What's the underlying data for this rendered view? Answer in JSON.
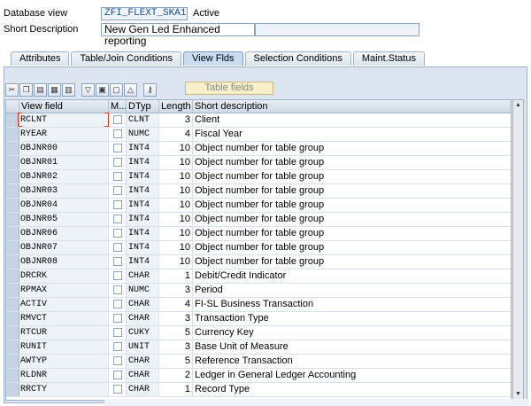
{
  "header": {
    "db_view_label": "Database view",
    "db_view_value": "ZFI_FLEXT_SKA1",
    "status": "Active",
    "short_desc_label": "Short Description",
    "short_desc_value": "New Gen Led Enhanced reporting"
  },
  "tabs": [
    {
      "label": "Attributes"
    },
    {
      "label": "Table/Join Conditions"
    },
    {
      "label": "View Flds"
    },
    {
      "label": "Selection Conditions"
    },
    {
      "label": "Maint.Status"
    }
  ],
  "active_tab": "View Flds",
  "toolbar": {
    "table_fields_label": "Table fields"
  },
  "grid": {
    "columns": [
      "View field",
      "M...",
      "DTyp",
      "Length",
      "Short description"
    ],
    "rows": [
      {
        "field": "RCLNT",
        "dtyp": "CLNT",
        "length": "3",
        "desc": "Client"
      },
      {
        "field": "RYEAR",
        "dtyp": "NUMC",
        "length": "4",
        "desc": "Fiscal Year"
      },
      {
        "field": "OBJNR00",
        "dtyp": "INT4",
        "length": "10",
        "desc": "Object number for table group"
      },
      {
        "field": "OBJNR01",
        "dtyp": "INT4",
        "length": "10",
        "desc": "Object number for table group"
      },
      {
        "field": "OBJNR02",
        "dtyp": "INT4",
        "length": "10",
        "desc": "Object number for table group"
      },
      {
        "field": "OBJNR03",
        "dtyp": "INT4",
        "length": "10",
        "desc": "Object number for table group"
      },
      {
        "field": "OBJNR04",
        "dtyp": "INT4",
        "length": "10",
        "desc": "Object number for table group"
      },
      {
        "field": "OBJNR05",
        "dtyp": "INT4",
        "length": "10",
        "desc": "Object number for table group"
      },
      {
        "field": "OBJNR06",
        "dtyp": "INT4",
        "length": "10",
        "desc": "Object number for table group"
      },
      {
        "field": "OBJNR07",
        "dtyp": "INT4",
        "length": "10",
        "desc": "Object number for table group"
      },
      {
        "field": "OBJNR08",
        "dtyp": "INT4",
        "length": "10",
        "desc": "Object number for table group"
      },
      {
        "field": "DRCRK",
        "dtyp": "CHAR",
        "length": "1",
        "desc": "Debit/Credit Indicator"
      },
      {
        "field": "RPMAX",
        "dtyp": "NUMC",
        "length": "3",
        "desc": "Period"
      },
      {
        "field": "ACTIV",
        "dtyp": "CHAR",
        "length": "4",
        "desc": "FI-SL Business Transaction"
      },
      {
        "field": "RMVCT",
        "dtyp": "CHAR",
        "length": "3",
        "desc": "Transaction Type"
      },
      {
        "field": "RTCUR",
        "dtyp": "CUKY",
        "length": "5",
        "desc": "Currency Key"
      },
      {
        "field": "RUNIT",
        "dtyp": "UNIT",
        "length": "3",
        "desc": "Base Unit of Measure"
      },
      {
        "field": "AWTYP",
        "dtyp": "CHAR",
        "length": "5",
        "desc": "Reference Transaction"
      },
      {
        "field": "RLDNR",
        "dtyp": "CHAR",
        "length": "2",
        "desc": "Ledger in General Ledger Accounting"
      },
      {
        "field": "RRCTY",
        "dtyp": "CHAR",
        "length": "1",
        "desc": "Record Type"
      }
    ]
  },
  "icons": [
    "cut-icon",
    "copy-icon",
    "paste-icon",
    "insert-row-icon",
    "delete-row-icon",
    "sort-icon",
    "select-all-icon",
    "deselect-icon",
    "detail-icon",
    "key-icon"
  ]
}
